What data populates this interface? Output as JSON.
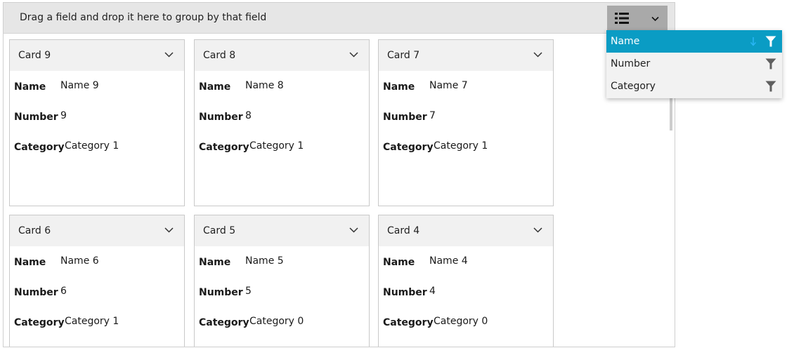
{
  "group_bar": {
    "hint": "Drag a field and drop it here to group by that field"
  },
  "view_button": {
    "icon": "list-icon",
    "dropdown_icon": "chevron-down-icon"
  },
  "cards": [
    {
      "title": "Card 9",
      "fields": {
        "name_label": "Name",
        "name_value": "Name 9",
        "number_label": "Number",
        "number_value": "9",
        "category_label": "Category",
        "category_value": "Category 1"
      }
    },
    {
      "title": "Card 8",
      "fields": {
        "name_label": "Name",
        "name_value": "Name 8",
        "number_label": "Number",
        "number_value": "8",
        "category_label": "Category",
        "category_value": "Category 1"
      }
    },
    {
      "title": "Card 7",
      "fields": {
        "name_label": "Name",
        "name_value": "Name 7",
        "number_label": "Number",
        "number_value": "7",
        "category_label": "Category",
        "category_value": "Category 1"
      }
    },
    {
      "title": "Card 6",
      "fields": {
        "name_label": "Name",
        "name_value": "Name 6",
        "number_label": "Number",
        "number_value": "6",
        "category_label": "Category",
        "category_value": "Category 1"
      }
    },
    {
      "title": "Card 5",
      "fields": {
        "name_label": "Name",
        "name_value": "Name 5",
        "number_label": "Number",
        "number_value": "5",
        "category_label": "Category",
        "category_value": "Category 0"
      }
    },
    {
      "title": "Card 4",
      "fields": {
        "name_label": "Name",
        "name_value": "Name 4",
        "number_label": "Number",
        "number_value": "4",
        "category_label": "Category",
        "category_value": "Category 0"
      }
    }
  ],
  "field_popup": {
    "items": [
      {
        "label": "Name",
        "selected": true,
        "sort": "descending"
      },
      {
        "label": "Number",
        "selected": false
      },
      {
        "label": "Category",
        "selected": false
      }
    ]
  },
  "colors": {
    "accent": "#0a9cc4",
    "sort_arrow": "#29b6f6",
    "header_bar": "#e6e6e6",
    "card_header": "#f1f1f1",
    "view_button": "#a9a9a9"
  }
}
